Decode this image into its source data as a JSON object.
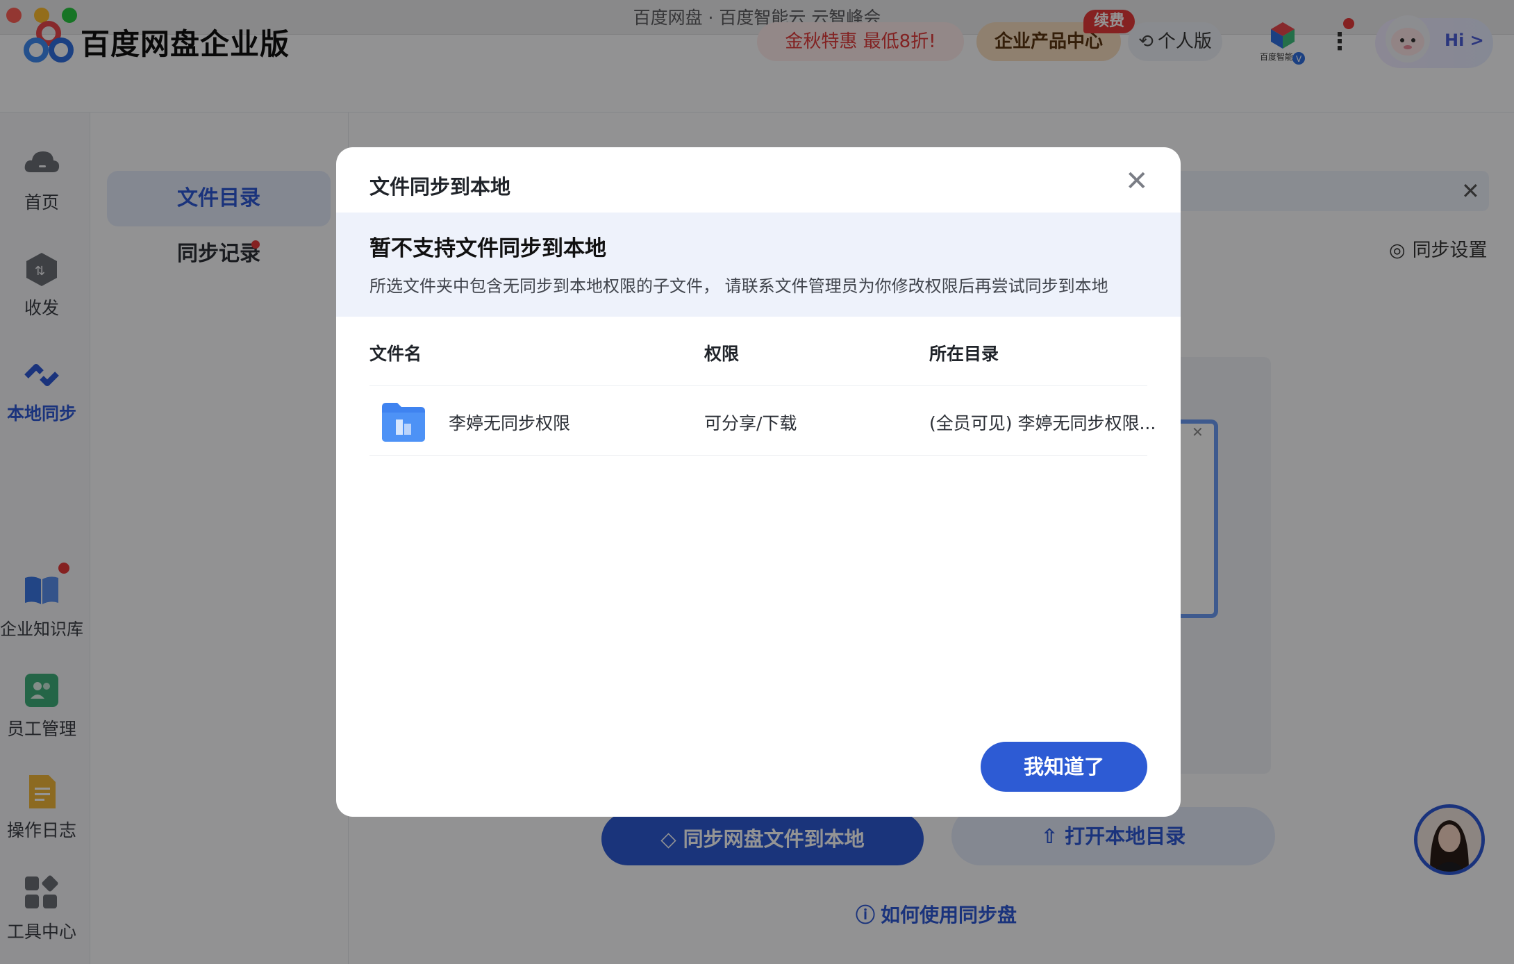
{
  "window": {
    "title": "百度网盘 · 百度智能云 云智峰会"
  },
  "header": {
    "brand": "百度网盘企业版",
    "promo_label": "金秋特惠 最低8折!",
    "product_center_label": "企业产品中心",
    "renew_badge": "续费",
    "personal_label": "个人版",
    "greeting": "Hi >"
  },
  "sidebar": {
    "items": [
      {
        "label": "首页",
        "icon": "cloud-icon"
      },
      {
        "label": "收发",
        "icon": "transfer-icon"
      },
      {
        "label": "本地同步",
        "icon": "sync-icon",
        "active": true
      },
      {
        "label": "企业知识库",
        "icon": "book-icon",
        "badge": true
      },
      {
        "label": "员工管理",
        "icon": "people-icon"
      },
      {
        "label": "操作日志",
        "icon": "log-icon"
      },
      {
        "label": "工具中心",
        "icon": "tools-icon"
      }
    ]
  },
  "subnav": {
    "tabs": [
      {
        "label": "文件目录",
        "active": true
      },
      {
        "label": "同步记录",
        "badge": true
      }
    ]
  },
  "main": {
    "sync_settings_label": "同步设置",
    "sync_button_label": "同步网盘文件到本地",
    "open_local_label": "打开本地目录",
    "howto_label": "如何使用同步盘"
  },
  "modal": {
    "title": "文件同步到本地",
    "warning_heading": "暂不支持文件同步到本地",
    "warning_text": "所选文件夹中包含无同步到本地权限的子文件，  请联系文件管理员为你修改权限后再尝试同步到本地",
    "columns": [
      "文件名",
      "权限",
      "所在目录"
    ],
    "rows": [
      {
        "name": "李婷无同步权限",
        "permission": "可分享/下载",
        "directory": "(全员可见) 李婷无同步权限..."
      }
    ],
    "ok_label": "我知道了"
  },
  "colors": {
    "accent": "#2d58d6",
    "danger": "#e63a3a"
  }
}
